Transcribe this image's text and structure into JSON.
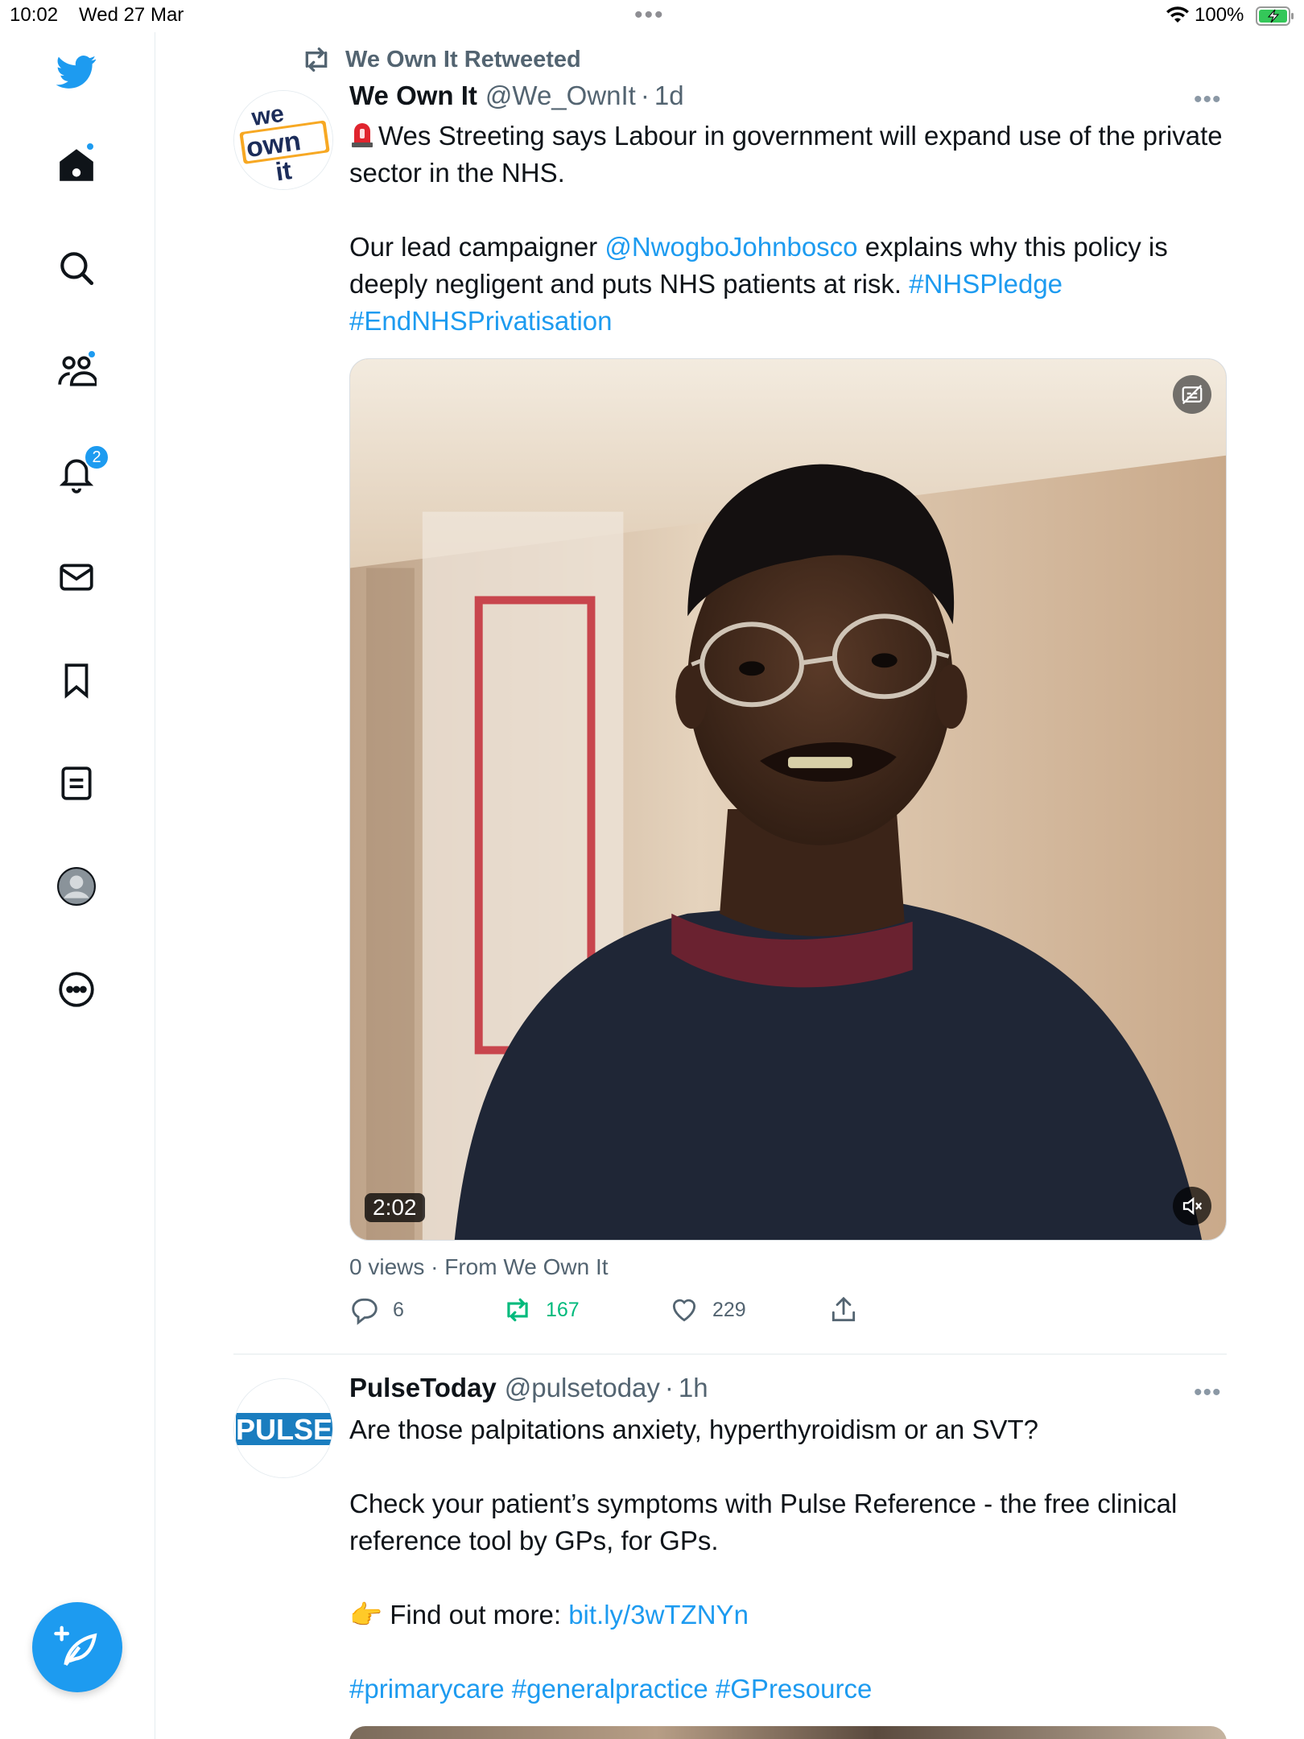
{
  "status_bar": {
    "time": "10:02",
    "date": "Wed 27 Mar",
    "battery_percent": "100%"
  },
  "sidebar": {
    "items": [
      {
        "name": "twitter-logo",
        "icon": "bird"
      },
      {
        "name": "home",
        "icon": "home",
        "has_dot": true
      },
      {
        "name": "explore",
        "icon": "search"
      },
      {
        "name": "communities",
        "icon": "people",
        "has_dot": true
      },
      {
        "name": "notifications",
        "icon": "bell",
        "badge": "2"
      },
      {
        "name": "messages",
        "icon": "envelope"
      },
      {
        "name": "bookmarks",
        "icon": "bookmark"
      },
      {
        "name": "lists",
        "icon": "list"
      },
      {
        "name": "profile",
        "icon": "avatar"
      },
      {
        "name": "more",
        "icon": "ellipsis-circle"
      }
    ],
    "compose": {
      "icon": "feather-plus"
    }
  },
  "timeline": {
    "tweets": [
      {
        "retweeted_by": "We Own It Retweeted",
        "avatar_text": [
          "we",
          "own",
          "it"
        ],
        "name": "We Own It",
        "handle": "@We_OwnIt",
        "time": "1d",
        "text": {
          "line1": "Wes Streeting says Labour in government will expand use of the private sector in the NHS.",
          "line2_pre": "Our lead campaigner ",
          "mention": "@NwogboJohnbosco",
          "line2_post": " explains why this policy is deeply negligent and puts NHS patients at risk. ",
          "hashtag1": "#NHSPledge",
          "hashtag2": "#EndNHSPrivatisation"
        },
        "video": {
          "duration": "2:02"
        },
        "views_line": "0 views · From We Own It",
        "stats": {
          "replies": "6",
          "retweets": "167",
          "likes": "229"
        }
      },
      {
        "avatar_text": "PULSE",
        "name": "PulseToday",
        "handle": "@pulsetoday",
        "time": "1h",
        "text": {
          "line1": "Are those palpitations anxiety, hyperthyroidism or an SVT?",
          "line2": "Check your patient’s symptoms with Pulse Reference - the free clinical reference tool by GPs, for GPs.",
          "line3_emoji": "👉",
          "line3_pre": "Find out more: ",
          "link": "bit.ly/3wTZNYn",
          "hashtags": [
            "#primarycare",
            "#generalpractice",
            "#GPresource"
          ]
        }
      }
    ]
  },
  "colors": {
    "accent": "#1d9bf0",
    "retweet_green": "#00ba7c",
    "secondary_text": "#536471"
  }
}
